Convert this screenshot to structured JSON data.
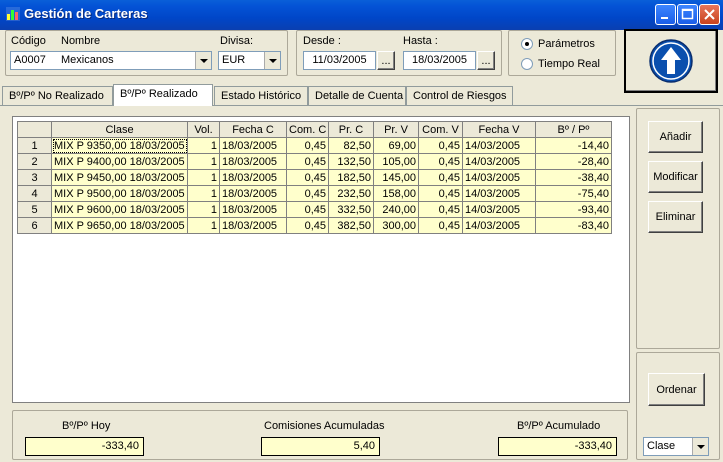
{
  "window": {
    "title": "Gestión de Carteras"
  },
  "header": {
    "codigo_label": "Código",
    "codigo_value": "A0007",
    "nombre_label": "Nombre",
    "nombre_value": "Mexicanos",
    "divisa_label": "Divisa:",
    "divisa_value": "EUR",
    "desde_label": "Desde :",
    "desde_value": "11/03/2005",
    "hasta_label": "Hasta :",
    "hasta_value": "18/03/2005",
    "browse_label": "...",
    "radio_parametros": "Parámetros",
    "radio_tiempo_real": "Tiempo Real"
  },
  "tabs": [
    {
      "label": "Bº/Pº No Realizado"
    },
    {
      "label": "Bº/Pº Realizado"
    },
    {
      "label": "Estado Histórico"
    },
    {
      "label": "Detalle de Cuenta"
    },
    {
      "label": "Control de Riesgos"
    }
  ],
  "grid": {
    "columns": [
      "Clase",
      "Vol.",
      "Fecha C",
      "Com. C",
      "Pr. C",
      "Pr. V",
      "Com. V",
      "Fecha V",
      "Bº / Pº"
    ],
    "rows": [
      {
        "n": "1",
        "cells": [
          "MIX P 9350,00 18/03/2005",
          "1",
          "18/03/2005",
          "0,45",
          "82,50",
          "69,00",
          "0,45",
          "14/03/2005",
          "-14,40"
        ]
      },
      {
        "n": "2",
        "cells": [
          "MIX P 9400,00 18/03/2005",
          "1",
          "18/03/2005",
          "0,45",
          "132,50",
          "105,00",
          "0,45",
          "14/03/2005",
          "-28,40"
        ]
      },
      {
        "n": "3",
        "cells": [
          "MIX P 9450,00 18/03/2005",
          "1",
          "18/03/2005",
          "0,45",
          "182,50",
          "145,00",
          "0,45",
          "14/03/2005",
          "-38,40"
        ]
      },
      {
        "n": "4",
        "cells": [
          "MIX P 9500,00 18/03/2005",
          "1",
          "18/03/2005",
          "0,45",
          "232,50",
          "158,00",
          "0,45",
          "14/03/2005",
          "-75,40"
        ]
      },
      {
        "n": "5",
        "cells": [
          "MIX P 9600,00 18/03/2005",
          "1",
          "18/03/2005",
          "0,45",
          "332,50",
          "240,00",
          "0,45",
          "14/03/2005",
          "-93,40"
        ]
      },
      {
        "n": "6",
        "cells": [
          "MIX P 9650,00 18/03/2005",
          "1",
          "18/03/2005",
          "0,45",
          "382,50",
          "300,00",
          "0,45",
          "14/03/2005",
          "-83,40"
        ]
      }
    ]
  },
  "buttons": {
    "anadir": "Añadir",
    "modificar": "Modificar",
    "eliminar": "Eliminar",
    "ordenar": "Ordenar"
  },
  "sort": {
    "value": "Clase"
  },
  "totals": {
    "hoy_label": "Bº/Pº Hoy",
    "hoy_value": "-333,40",
    "comisiones_label": "Comisiones Acumuladas",
    "comisiones_value": "5,40",
    "acumulado_label": "Bº/Pº Acumulado",
    "acumulado_value": "-333,40"
  },
  "colors": {
    "titlebar": "#0453d6",
    "grid_cell": "#ffffcc",
    "up_button": "#0a4fae"
  },
  "icons": [
    "app-icon",
    "minimize-icon",
    "maximize-icon",
    "close-icon",
    "up-arrow-icon"
  ]
}
